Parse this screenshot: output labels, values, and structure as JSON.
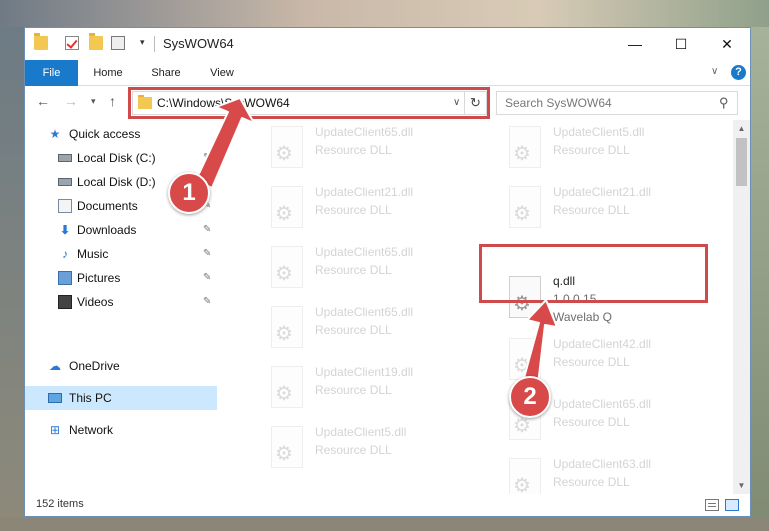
{
  "window": {
    "title": "SysWOW64",
    "minimize_glyph": "—",
    "maximize_glyph": "☐",
    "close_glyph": "✕"
  },
  "ribbon": {
    "tabs": [
      "File",
      "Home",
      "Share",
      "View"
    ],
    "help_glyph": "?"
  },
  "address": {
    "path": "C:\\Windows\\SysWOW64",
    "search_placeholder": "Search SysWOW64"
  },
  "nav_pane": {
    "items": [
      {
        "label": "Quick access",
        "icon": "star-icon"
      },
      {
        "label": "Local Disk (C:)",
        "icon": "drive-icon"
      },
      {
        "label": "Local Disk (D:)",
        "icon": "drive-icon"
      },
      {
        "label": "Documents",
        "icon": "documents-icon"
      },
      {
        "label": "Downloads",
        "icon": "downloads-icon"
      },
      {
        "label": "Music",
        "icon": "music-icon"
      },
      {
        "label": "Pictures",
        "icon": "pictures-icon"
      },
      {
        "label": "Videos",
        "icon": "videos-icon"
      },
      {
        "label": "OneDrive",
        "icon": "onedrive-icon"
      },
      {
        "label": "This PC",
        "icon": "this-pc-icon",
        "selected": true
      },
      {
        "label": "Network",
        "icon": "network-icon"
      }
    ]
  },
  "files": {
    "left": [
      {
        "name": "UpdateClient65.dll",
        "type": "Resource DLL"
      },
      {
        "name": "UpdateClient21.dll",
        "type": "Resource DLL"
      },
      {
        "name": "UpdateClient65.dll",
        "type": "Resource DLL"
      },
      {
        "name": "UpdateClient65.dll",
        "type": "Resource DLL"
      },
      {
        "name": "UpdateClient19.dll",
        "type": "Resource DLL"
      },
      {
        "name": "UpdateClient5.dll",
        "type": "Resource DLL"
      }
    ],
    "right": [
      {
        "name": "UpdateClient5.dll",
        "type": "Resource DLL"
      },
      {
        "name": "UpdateClient21.dll",
        "type": "Resource DLL"
      },
      {
        "name": "q.dll",
        "version": "1.0.0.15",
        "company": "Wavelab Q"
      },
      {
        "name": "UpdateClient42.dll",
        "type": "Resource DLL"
      },
      {
        "name": "UpdateClient65.dll",
        "type": "Resource DLL"
      },
      {
        "name": "UpdateClient63.dll",
        "type": "Resource DLL"
      }
    ]
  },
  "status": {
    "item_count": "152 items"
  },
  "annotations": {
    "step1": "1",
    "step2": "2",
    "color": "#d84a4a"
  }
}
